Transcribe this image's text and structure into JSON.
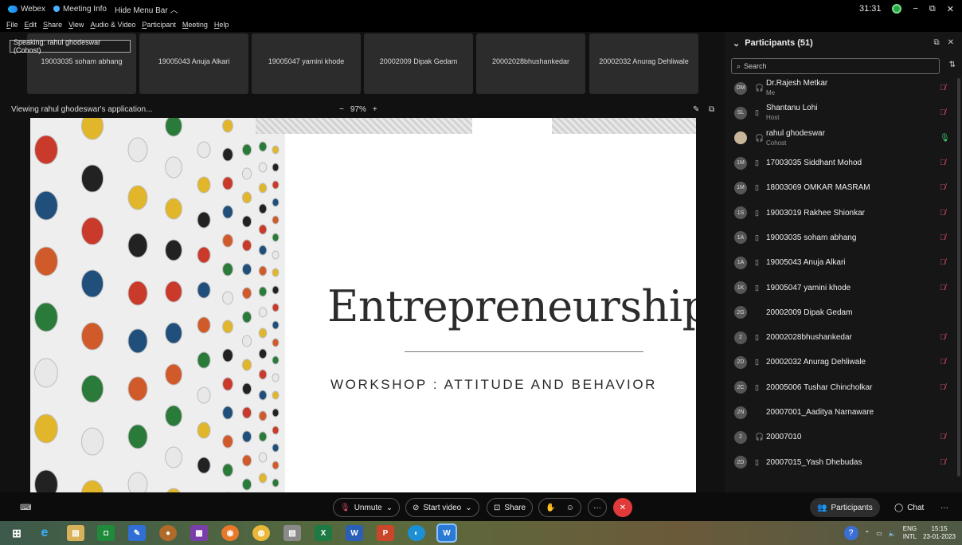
{
  "titlebar": {
    "app": "Webex",
    "meeting_info": "Meeting Info",
    "hide_menu": "Hide Menu Bar ︿",
    "timer": "31:31",
    "minimize": "−",
    "restore": "⧉",
    "close": "✕"
  },
  "menu": [
    "File",
    "Edit",
    "Share",
    "View",
    "Audio & Video",
    "Participant",
    "Meeting",
    "Help"
  ],
  "speaking": "Speaking: rahul ghodeswar (Cohost)",
  "thumbnails": [
    "19003035 soham abhang",
    "19005043 Anuja Alkari",
    "19005047 yamini khode",
    "20002009 Dipak Gedam",
    "20002028bhushankedar",
    "20002032 Anurag Dehliwale"
  ],
  "viewbar": {
    "viewing": "Viewing rahul ghodeswar's application...",
    "zoom_out": "−",
    "zoom": "97%",
    "zoom_in": "+"
  },
  "slide": {
    "title": "Entrepreneurship",
    "subtitle": "WORKSHOP : ATTITUDE AND BEHAVIOR"
  },
  "panel": {
    "title": "Participants (51)",
    "search_placeholder": "Search",
    "participants": [
      {
        "initials": "DM",
        "name": "Dr.Rajesh Metkar",
        "role": "Me",
        "device": "headset",
        "mic": "muted"
      },
      {
        "initials": "SL",
        "name": "Shantanu Lohi",
        "role": "Host",
        "device": "screen",
        "mic": "muted"
      },
      {
        "initials": "",
        "name": "rahul ghodeswar",
        "role": "Cohost",
        "device": "headset",
        "mic": "active"
      },
      {
        "initials": "1M",
        "name": "17003035 Siddhant Mohod",
        "role": "",
        "device": "screen",
        "mic": "muted"
      },
      {
        "initials": "1M",
        "name": "18003069 OMKAR MASRAM",
        "role": "",
        "device": "screen",
        "mic": "muted"
      },
      {
        "initials": "1S",
        "name": "19003019 Rakhee Shionkar",
        "role": "",
        "device": "screen",
        "mic": "muted"
      },
      {
        "initials": "1A",
        "name": "19003035 soham abhang",
        "role": "",
        "device": "screen",
        "mic": "muted"
      },
      {
        "initials": "1A",
        "name": "19005043 Anuja Alkari",
        "role": "",
        "device": "screen",
        "mic": "muted"
      },
      {
        "initials": "1K",
        "name": "19005047 yamini khode",
        "role": "",
        "device": "screen",
        "mic": "muted"
      },
      {
        "initials": "2G",
        "name": "20002009 Dipak Gedam",
        "role": "",
        "device": "",
        "mic": ""
      },
      {
        "initials": "2",
        "name": "20002028bhushankedar",
        "role": "",
        "device": "screen",
        "mic": "muted"
      },
      {
        "initials": "2D",
        "name": "20002032 Anurag Dehliwale",
        "role": "",
        "device": "screen",
        "mic": "muted"
      },
      {
        "initials": "2C",
        "name": "20005006 Tushar Chincholkar",
        "role": "",
        "device": "screen",
        "mic": "muted"
      },
      {
        "initials": "2N",
        "name": "20007001_Aaditya Narnaware",
        "role": "",
        "device": "",
        "mic": ""
      },
      {
        "initials": "2",
        "name": "20007010",
        "role": "",
        "device": "headset",
        "mic": "muted"
      },
      {
        "initials": "2D",
        "name": "20007015_Yash Dhebudas",
        "role": "",
        "device": "screen",
        "mic": "muted"
      }
    ]
  },
  "controls": {
    "unmute": "Unmute",
    "start_video": "Start video",
    "share": "Share",
    "more": "···",
    "end": "✕",
    "participants": "Participants",
    "chat": "Chat",
    "overflow": "···"
  },
  "taskbar": {
    "lang": "ENG",
    "lang2": "INTL",
    "time": "15:15",
    "date": "23-01-2023",
    "help": "?"
  },
  "colors": {
    "panel_bg": "#161616",
    "end_button": "#e03a3a",
    "mic_muted": "#e0506a",
    "mic_active": "#3ccf6e"
  }
}
